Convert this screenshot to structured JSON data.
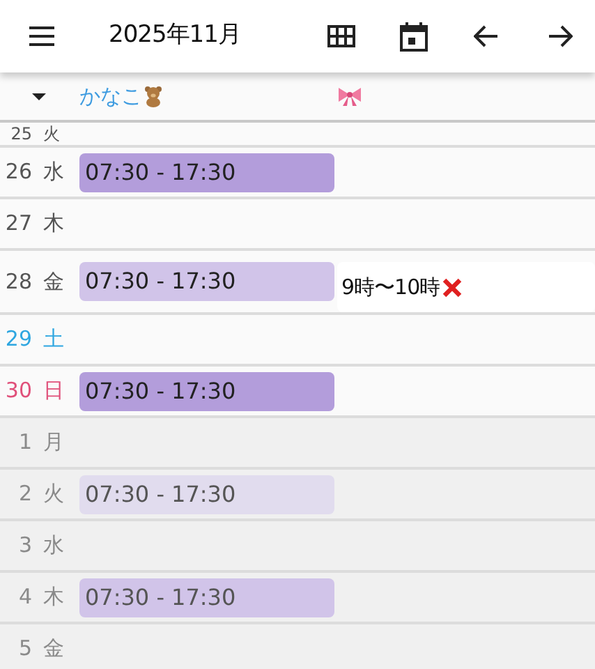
{
  "header": {
    "title": "2025年11月"
  },
  "members": [
    {
      "name": "かなこ",
      "kind": "bear"
    },
    {
      "kind": "bow"
    }
  ],
  "days": [
    {
      "date": "25",
      "weekday": "火",
      "kind": "weekday",
      "other_month": false
    },
    {
      "date": "26",
      "weekday": "水",
      "kind": "weekday",
      "other_month": false,
      "shift": {
        "time": "07:30 - 17:30",
        "color": "#b39ddb"
      }
    },
    {
      "date": "27",
      "weekday": "木",
      "kind": "weekday",
      "other_month": false
    },
    {
      "date": "28",
      "weekday": "金",
      "kind": "weekday",
      "other_month": false,
      "shift": {
        "time": "07:30 - 17:30",
        "color": "#d1c4e9"
      },
      "note": {
        "text": "9時〜10時"
      }
    },
    {
      "date": "29",
      "weekday": "土",
      "kind": "saturday",
      "other_month": false
    },
    {
      "date": "30",
      "weekday": "日",
      "kind": "sunday",
      "other_month": false,
      "shift": {
        "time": "07:30 - 17:30",
        "color": "#b39ddb"
      }
    },
    {
      "date": "1",
      "weekday": "月",
      "kind": "weekday",
      "other_month": true
    },
    {
      "date": "2",
      "weekday": "火",
      "kind": "weekday",
      "other_month": true,
      "shift": {
        "time": "07:30 - 17:30",
        "color": "#e1dcee"
      }
    },
    {
      "date": "3",
      "weekday": "水",
      "kind": "weekday",
      "other_month": true
    },
    {
      "date": "4",
      "weekday": "木",
      "kind": "weekday",
      "other_month": true,
      "shift": {
        "time": "07:30 - 17:30",
        "color": "#d1c4e9"
      }
    },
    {
      "date": "5",
      "weekday": "金",
      "kind": "weekday",
      "other_month": true
    }
  ]
}
